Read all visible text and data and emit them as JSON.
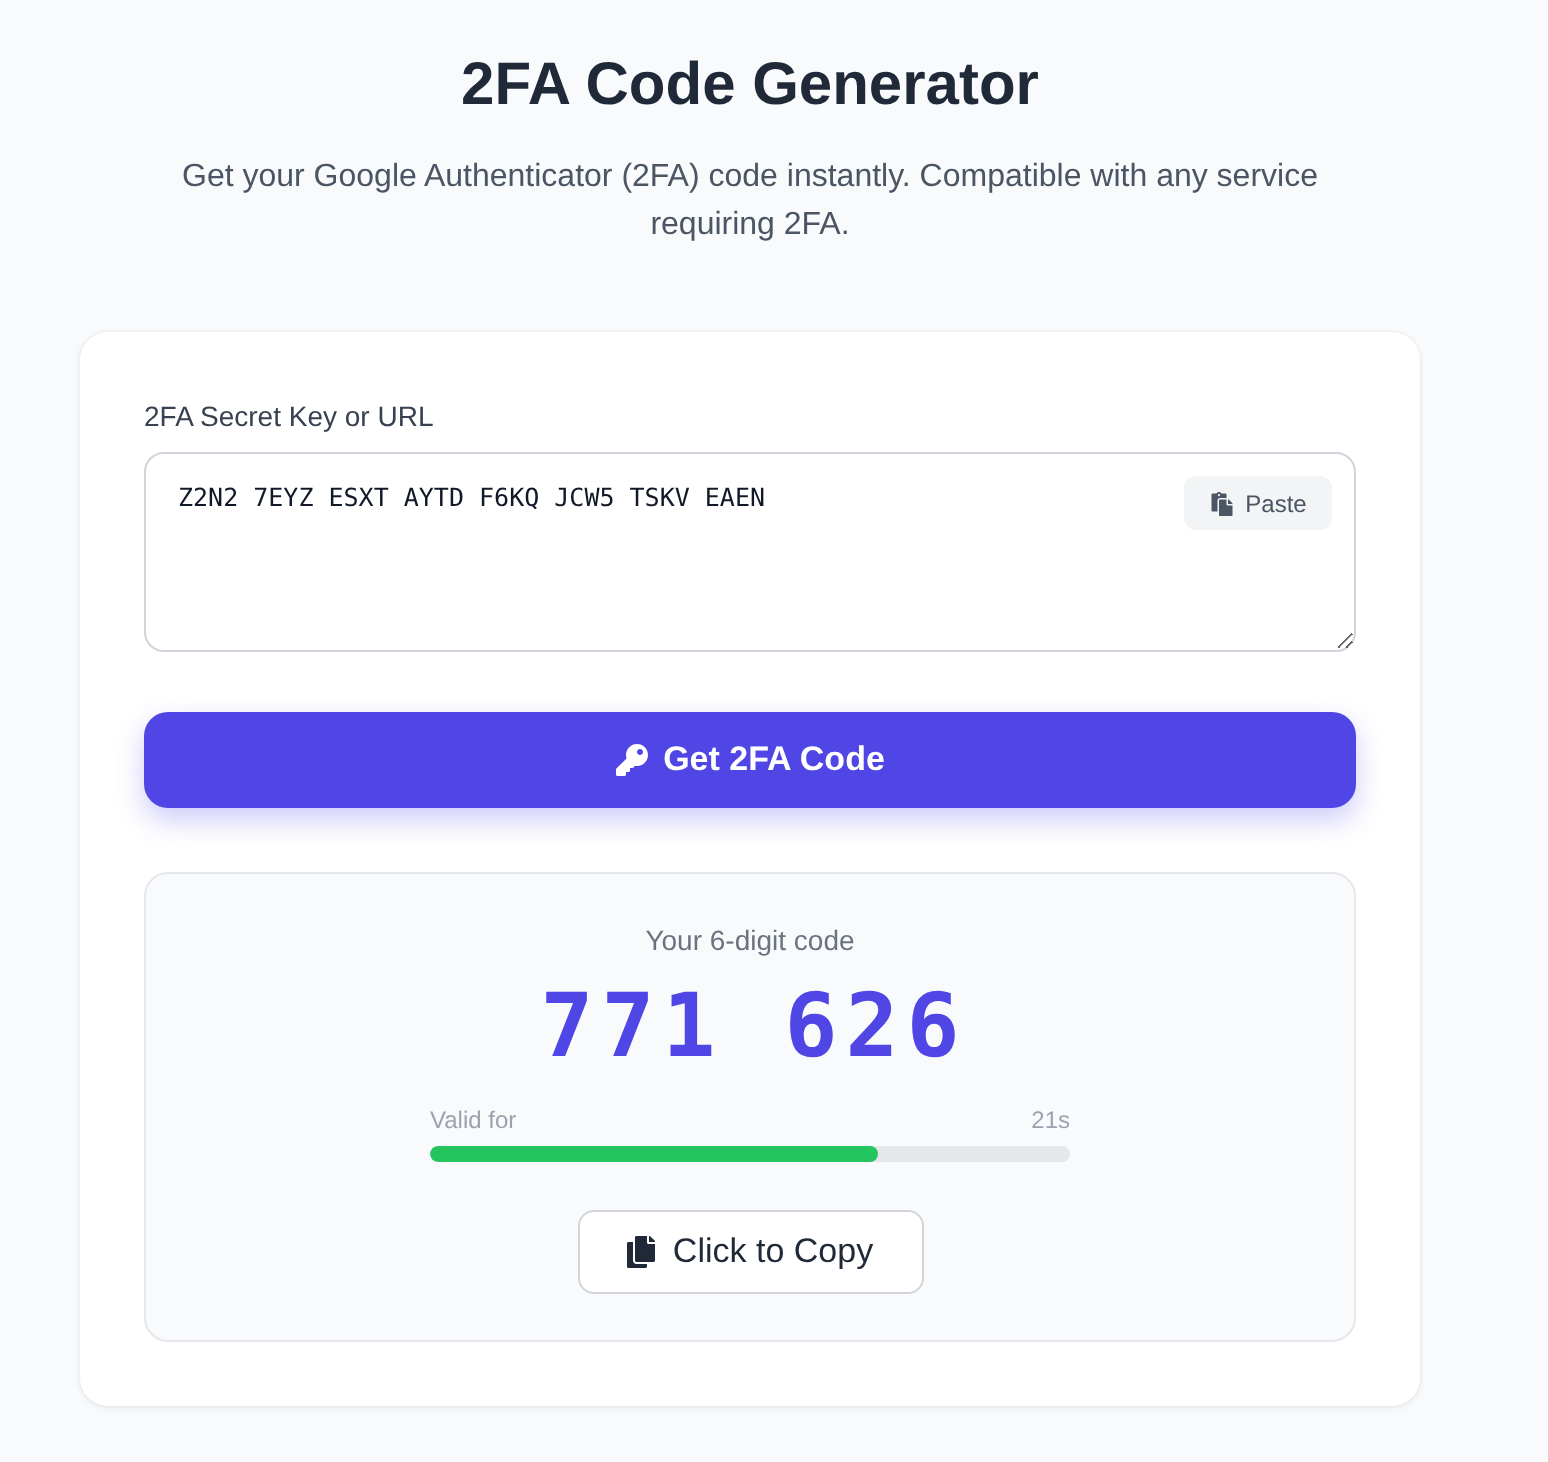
{
  "header": {
    "title": "2FA Code Generator",
    "subtitle": "Get your Google Authenticator (2FA) code instantly. Compatible with any service requiring 2FA."
  },
  "secret": {
    "label": "2FA Secret Key or URL",
    "value": "Z2N2 7EYZ ESXT AYTD F6KQ JCW5 TSKV EAEN",
    "paste_button": "Paste"
  },
  "generate_button": "Get 2FA Code",
  "result": {
    "caption": "Your 6-digit code",
    "code": "771 626",
    "timer": {
      "label": "Valid for",
      "reading": "21s",
      "level": 0.7
    },
    "copy_button": "Click to Copy"
  }
}
